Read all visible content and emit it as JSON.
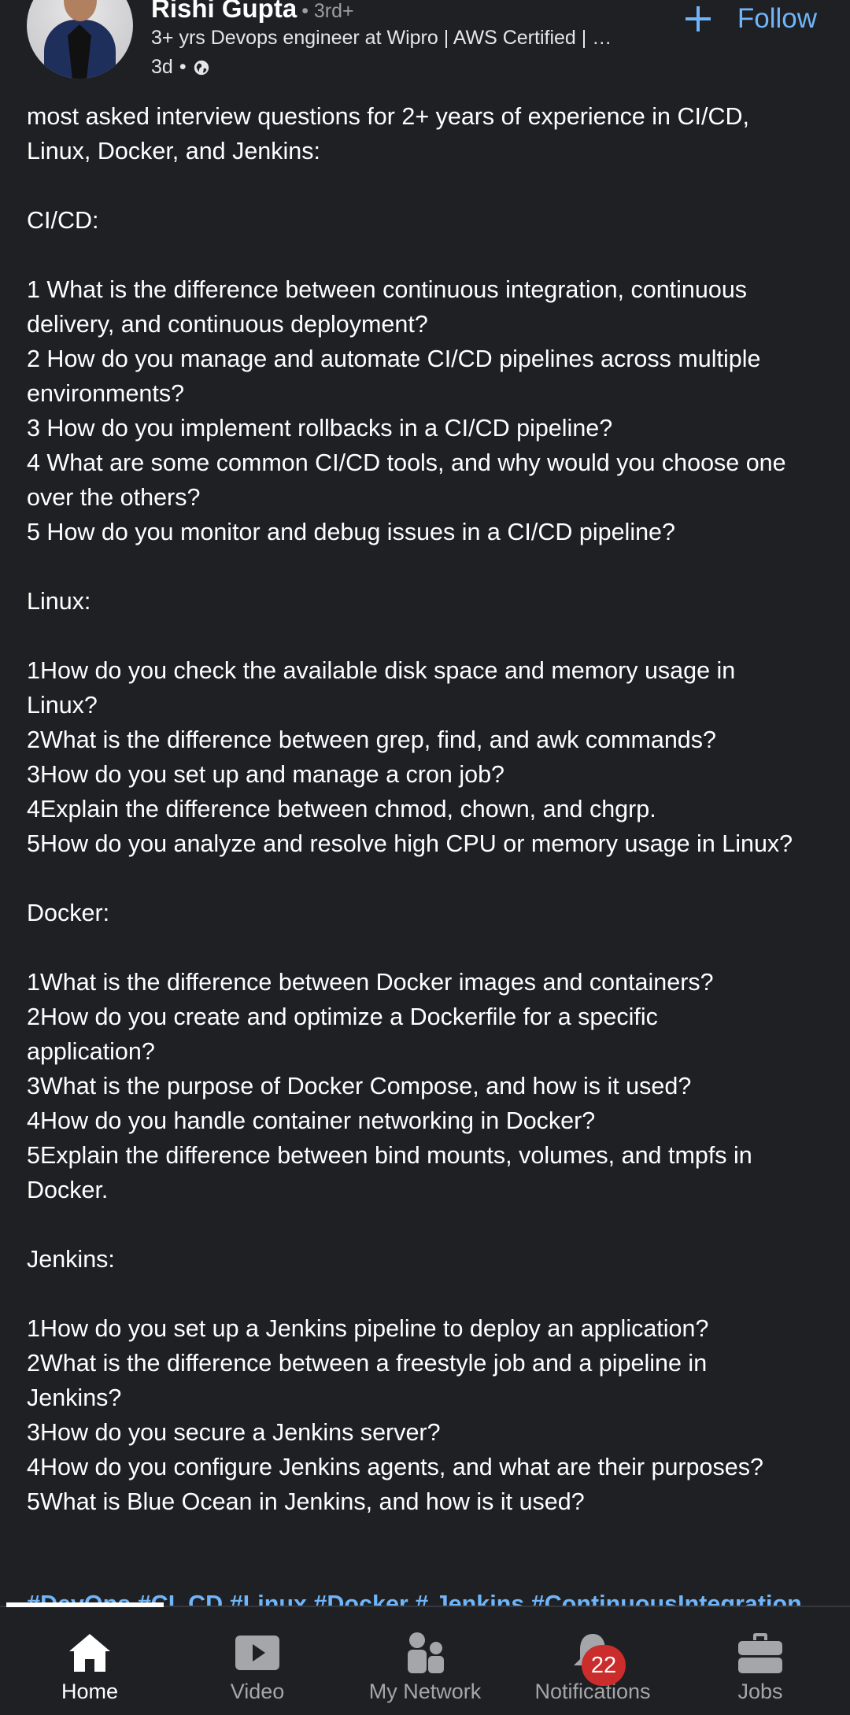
{
  "post": {
    "author_name": "Rishi Gupta",
    "degree": "• 3rd+",
    "headline": "3+ yrs Devops engineer at Wipro | AWS Certified | …",
    "time_ago": "3d",
    "dot": "•",
    "follow_label": "Follow",
    "body": {
      "intro_1": "most asked interview questions for 2+ years of experience in CI/CD,",
      "intro_2": "Linux, Docker, and Jenkins:",
      "cicd_heading": "CI/CD:",
      "cicd_1a": "1 What is the difference between continuous integration, continuous",
      "cicd_1b": "delivery, and continuous deployment?",
      "cicd_2a": "2 How do you manage and automate CI/CD pipelines across multiple",
      "cicd_2b": "environments?",
      "cicd_3": "3 How do you implement rollbacks in a CI/CD pipeline?",
      "cicd_4a": "4 What are some common CI/CD tools, and why would you choose one",
      "cicd_4b": "over the others?",
      "cicd_5": "5 How do you monitor and debug issues in a CI/CD pipeline?",
      "linux_heading": "Linux:",
      "linux_1a": "1How do you check the available disk space and memory usage in",
      "linux_1b": "Linux?",
      "linux_2": "2What is the difference between grep, find, and awk commands?",
      "linux_3": "3How do you set up and manage a cron job?",
      "linux_4": "4Explain the difference between chmod, chown, and chgrp.",
      "linux_5": "5How do you analyze and resolve high CPU or memory usage in Linux?",
      "docker_heading": "Docker:",
      "docker_1": "1What is the difference between Docker images and containers?",
      "docker_2a": "2How do you create and optimize a Dockerfile for a specific",
      "docker_2b": "application?",
      "docker_3": "3What is the purpose of Docker Compose, and how is it used?",
      "docker_4": "4How do you handle container networking in Docker?",
      "docker_5a": "5Explain the difference between bind mounts, volumes, and tmpfs in",
      "docker_5b": "Docker.",
      "jenkins_heading": "Jenkins:",
      "jenkins_1": "1How do you set up a Jenkins pipeline to deploy an application?",
      "jenkins_2a": "2What is the difference between a freestyle job and a pipeline in",
      "jenkins_2b": "Jenkins?",
      "jenkins_3": "3How do you secure a Jenkins server?",
      "jenkins_4": "4How do you configure Jenkins agents, and what are their purposes?",
      "jenkins_5": "5What is Blue Ocean in Jenkins, and how is it used?"
    },
    "hashtags": "#DevOps #CI_CD #Linux #Docker # Jenkins #ContinuousIntegration"
  },
  "nav": {
    "items": [
      {
        "label": "Home",
        "icon": "home-icon",
        "active": true
      },
      {
        "label": "Video",
        "icon": "video-icon"
      },
      {
        "label": "My Network",
        "icon": "network-icon"
      },
      {
        "label": "Notifications",
        "icon": "bell-icon",
        "badge": "22"
      },
      {
        "label": "Jobs",
        "icon": "briefcase-icon"
      }
    ]
  },
  "colors": {
    "background": "#1e2024",
    "link": "#70b5f9",
    "badge": "#cb2d2d"
  }
}
